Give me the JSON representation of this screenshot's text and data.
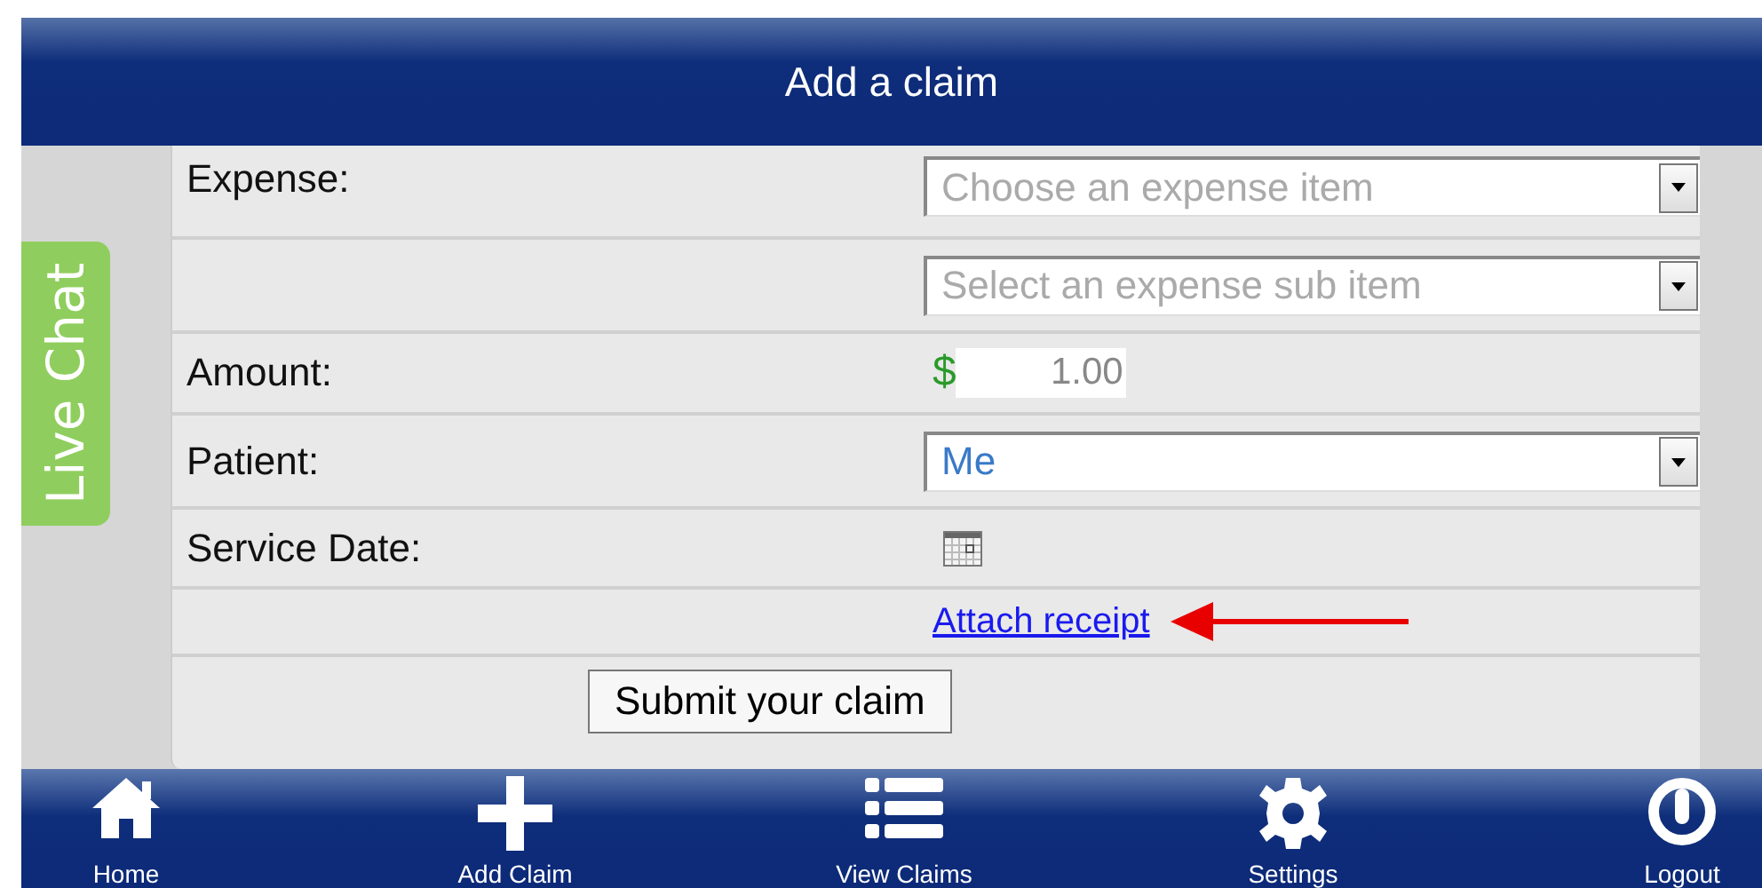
{
  "header": {
    "title": "Add a claim"
  },
  "live_chat": {
    "label": "Live Chat"
  },
  "form_rows": [
    {
      "kind": "select",
      "label": "Expense:",
      "placeholder": "Choose an expense item"
    },
    {
      "kind": "select",
      "placeholder": "Select an expense sub item"
    },
    {
      "kind": "amount",
      "label": "Amount:",
      "currency": "$",
      "value": "1.00"
    },
    {
      "kind": "select",
      "label": "Patient:",
      "value": "Me"
    },
    {
      "kind": "date",
      "label": "Service Date:"
    },
    {
      "kind": "link",
      "text": "Attach receipt",
      "annotated": true
    },
    {
      "kind": "button",
      "text": "Submit your claim"
    }
  ],
  "nav": [
    {
      "kind": "home",
      "label": "Home"
    },
    {
      "kind": "add",
      "label": "Add Claim"
    },
    {
      "kind": "list",
      "label": "View Claims"
    },
    {
      "kind": "settings",
      "label": "Settings"
    },
    {
      "kind": "logout",
      "label": "Logout"
    }
  ]
}
